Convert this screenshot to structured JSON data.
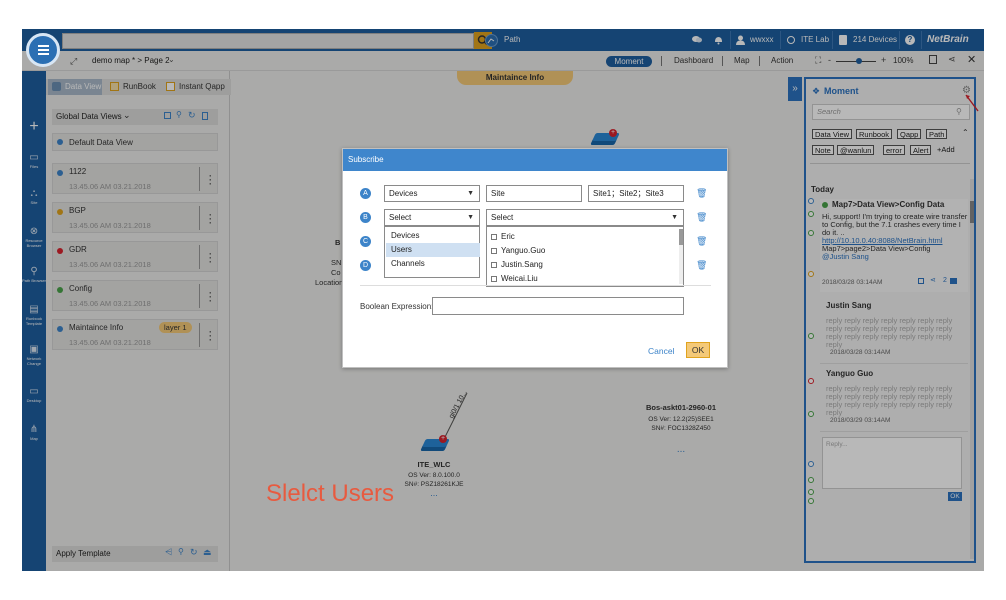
{
  "topbar": {
    "path_label": "Path",
    "user": "wwxxx",
    "lab": "ITE Lab",
    "devices": "214 Devices",
    "help": "?",
    "logo": "NetBrain"
  },
  "toolbar": {
    "map_title": "demo map * > Page 2",
    "moment": "Moment",
    "dashboard": "Dashboard",
    "map": "Map",
    "action": "Action",
    "zoom": "100%",
    "zoom_minus": "-",
    "zoom_plus": "+"
  },
  "left_nav": [
    {
      "label": "Files",
      "icon": "folder-icon"
    },
    {
      "label": "Site",
      "icon": "site-icon"
    },
    {
      "label": "Resource Browser",
      "icon": "resource-icon"
    },
    {
      "label": "Path Browser",
      "icon": "path-icon"
    },
    {
      "label": "Runbook Template",
      "icon": "runbook-icon"
    },
    {
      "label": "Network Change",
      "icon": "network-change-icon"
    },
    {
      "label": "Desktop",
      "icon": "desktop-icon"
    },
    {
      "label": "Map",
      "icon": "map-icon"
    }
  ],
  "panel_tabs": {
    "data_view": "Data View",
    "runbook": "RunBook",
    "instant_qapp": "Instant Qapp"
  },
  "data_views": {
    "header": "Global Data Views",
    "default": "Default Data View",
    "items": [
      {
        "name": "1122",
        "time": "13.45.06 AM 03.21.2018",
        "color": "#3d84c9"
      },
      {
        "name": "BGP",
        "time": "13.45.06 AM 03.21.2018",
        "color": "#e0a31e"
      },
      {
        "name": "GDR",
        "time": "13.45.06 AM 03.21.2018",
        "color": "#d9232e"
      },
      {
        "name": "Config",
        "time": "13.45.06 AM 03.21.2018",
        "color": "#4aa34a"
      },
      {
        "name": "Maintaince Info",
        "time": "13.45.06 AM 03.21.2018",
        "color": "#3d84c9",
        "tag": "layer 1"
      }
    ],
    "apply_template": "Apply Template"
  },
  "map": {
    "banner": "Maintaince Info",
    "left_labels": {
      "b": "B",
      "sn": "SN",
      "co": "Co",
      "location": "Location:"
    },
    "device1": {
      "name": "ITE_WLC",
      "os": "OS Ver: 8.0.100.0",
      "sn": "SN#: PSZ18261KJE"
    },
    "device2": {
      "name": "Bos-askt01-2960-01",
      "os": "OS Ver: 12.2(25)SEE1",
      "sn": "SN#: FOC1328Z450"
    },
    "link_label": "gi0/1 10...",
    "more": "..."
  },
  "moment": {
    "title": "Moment",
    "search_placeholder": "Search",
    "filters_row1": [
      "Data View",
      "Runbook",
      "Qapp",
      "Path"
    ],
    "filters_row2": [
      "Note",
      "@wanlun",
      "error",
      "Alert"
    ],
    "add": "+Add",
    "today": "Today",
    "post1": {
      "title": "Map7>Data View>Config Data",
      "body": "Hi, support! I'm trying to create wire transfer to Config, but the 7.1 crashes every time I do it. ..",
      "link": "http://10.10.0.40:8088/NetBrain.html",
      "path": "Map7>page2>Data View>Config",
      "mention": "@Justin Sang",
      "time": "2018/03/28 03:14AM",
      "count": "2"
    },
    "post2": {
      "author": "Justin Sang",
      "body": "reply reply reply reply reply reply reply reply reply reply reply reply reply reply reply reply reply reply reply reply reply reply",
      "time": "2018/03/28 03:14AM"
    },
    "post3": {
      "author": "Yanguo Guo",
      "body": "reply reply reply reply reply reply reply reply reply reply reply reply reply reply reply reply reply reply reply reply reply reply",
      "time": "2018/03/29 03:14AM"
    },
    "reply_placeholder": "Reply...",
    "ok": "OK"
  },
  "modal": {
    "title": "Subscribe",
    "rows": [
      {
        "badge": "A",
        "type": "Devices",
        "field": "Site",
        "value": "Site1；Site2；Site3"
      },
      {
        "badge": "B",
        "type": "Select",
        "field": "Select"
      },
      {
        "badge": "C"
      },
      {
        "badge": "D"
      }
    ],
    "type_options": [
      "Devices",
      "Users",
      "Channels"
    ],
    "selected_option": "Users",
    "users": [
      "Eric",
      "Yanguo.Guo",
      "Justin.Sang",
      "Weicai.Liu"
    ],
    "boolean_label": "Boolean Expression:",
    "boolean_value": "",
    "cancel": "Cancel",
    "ok": "OK"
  },
  "caption": "Slelct Users",
  "colors": {
    "brand": "#1e5fa0",
    "accent": "#e0a31e",
    "modal_header": "#3f86cc",
    "caption": "#e85a3f"
  }
}
